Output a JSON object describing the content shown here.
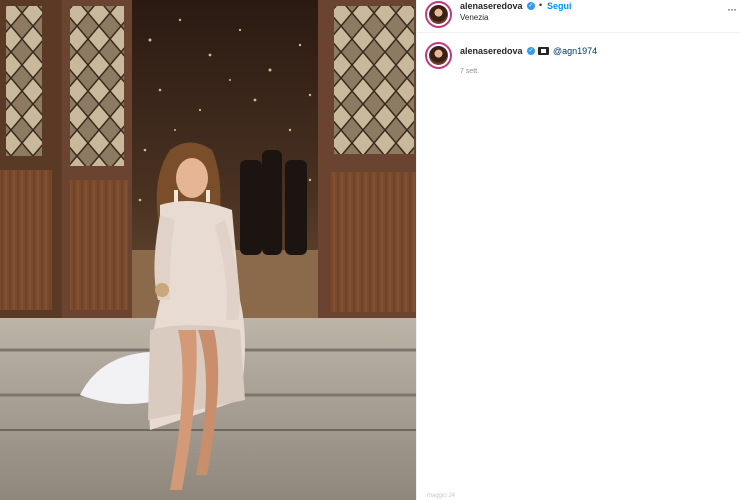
{
  "post": {
    "author": {
      "username": "alenaseredova",
      "verified_icon": "verified-badge-icon",
      "follow_label": "Segui",
      "separator": "•",
      "location": "Venezia"
    },
    "more_icon": "more-options-icon",
    "more_label": "···",
    "caption": {
      "username": "alenaseredova",
      "icon": "clapperboard-icon",
      "mention": "@agn1974",
      "timestamp": "7 sett."
    },
    "cut_off_text": "maggio 24",
    "colors": {
      "accent": "#0095f6",
      "verified": "#3897f0",
      "text": "#262626",
      "muted": "#8e8e8e",
      "story_ring": "#c13584"
    }
  }
}
